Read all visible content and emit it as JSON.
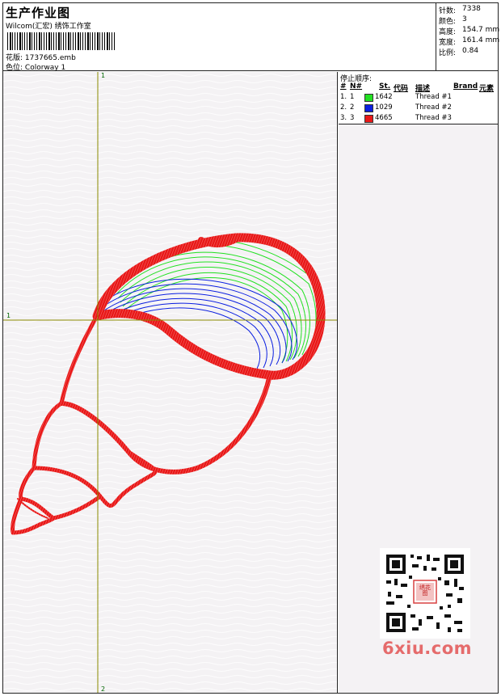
{
  "header": {
    "title": "生产作业图",
    "subtitle": "Wilcom(汇宏) 绣饰工作室",
    "design_label": "花版:",
    "design_value": "1737665.emb",
    "colorway_label": "色位:",
    "colorway_value": "Colorway 1"
  },
  "stats": [
    {
      "label": "针数:",
      "value": "7338"
    },
    {
      "label": "颜色:",
      "value": "3"
    },
    {
      "label": "高度:",
      "value": "154.7 mm"
    },
    {
      "label": "宽度:",
      "value": "161.4 mm"
    },
    {
      "label": "比例:",
      "value": "0.84"
    }
  ],
  "sequence": {
    "title": "停止顺序:",
    "columns": [
      "#",
      "N#",
      "St.",
      "代码",
      "描述",
      "Brand",
      "元素"
    ],
    "rows": [
      {
        "idx": "1.",
        "n": "1",
        "code": "1642",
        "desc": "Thread #1",
        "color": "#22e022"
      },
      {
        "idx": "2.",
        "n": "2",
        "code": "1029",
        "desc": "Thread #2",
        "color": "#0a1ee0"
      },
      {
        "idx": "3.",
        "n": "3",
        "code": "4665",
        "desc": "Thread #3",
        "color": "#e81818"
      }
    ]
  },
  "axes": {
    "v_top": "1",
    "v_bottom": "2",
    "h_left": "1"
  },
  "colors": {
    "green": "#22e022",
    "blue": "#0a1ee0",
    "red": "#e81818",
    "axis": "#8a8a00"
  },
  "watermark": "6xiu.com",
  "qr_stamp": "绣花图"
}
